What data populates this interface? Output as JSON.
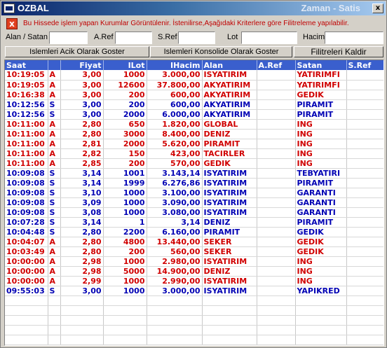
{
  "window": {
    "title": "OZBAL",
    "subtitle": "Zaman - Satis",
    "close_label": "x"
  },
  "info": {
    "icon_label": "x",
    "message": "Bu Hissede işlem yapan Kurumlar Görüntülenir. İstenilirse,Aşağıdaki Kriterlere göre Filitreleme yapılabilir."
  },
  "filters": {
    "alan_satan_label": "Alan / Satan",
    "aref_label": "A.Ref",
    "sref_label": "S.Ref",
    "lot_label": "Lot",
    "hacim_label": "Hacim",
    "alan_satan_value": "",
    "aref_value": "",
    "sref_value": "",
    "lot_value": "",
    "hacim_value": ""
  },
  "buttons": {
    "acik_label": "Islemleri Acik Olarak Goster",
    "konsolide_label": "Islemleri Konsolide Olarak Goster",
    "kaldir_label": "Filitreleri Kaldir"
  },
  "grid": {
    "columns": [
      "Saat",
      "",
      "Fiyat",
      "ILot",
      "IHacim",
      "Alan",
      "A.Ref",
      "Satan",
      "S.Ref"
    ],
    "colors": {
      "buy": "#d00000",
      "sell": "#0000b4",
      "header_bg": "#3a5fcd"
    },
    "rows": [
      {
        "saat": "10:19:05",
        "tip": "A",
        "fiyat": "3,00",
        "lot": "1000",
        "hacim": "3.000,00",
        "alan": "ISYATIRIM",
        "aref": "",
        "satan": "YATIRIMFI",
        "sref": ""
      },
      {
        "saat": "10:19:05",
        "tip": "A",
        "fiyat": "3,00",
        "lot": "12600",
        "hacim": "37.800,00",
        "alan": "AKYATIRIM",
        "aref": "",
        "satan": "YATIRIMFI",
        "sref": ""
      },
      {
        "saat": "10:16:38",
        "tip": "A",
        "fiyat": "3,00",
        "lot": "200",
        "hacim": "600,00",
        "alan": "AKYATIRIM",
        "aref": "",
        "satan": "GEDIK",
        "sref": ""
      },
      {
        "saat": "10:12:56",
        "tip": "S",
        "fiyat": "3,00",
        "lot": "200",
        "hacim": "600,00",
        "alan": "AKYATIRIM",
        "aref": "",
        "satan": "PIRAMIT",
        "sref": ""
      },
      {
        "saat": "10:12:56",
        "tip": "S",
        "fiyat": "3,00",
        "lot": "2000",
        "hacim": "6.000,00",
        "alan": "AKYATIRIM",
        "aref": "",
        "satan": "PIRAMIT",
        "sref": ""
      },
      {
        "saat": "10:11:00",
        "tip": "A",
        "fiyat": "2,80",
        "lot": "650",
        "hacim": "1.820,00",
        "alan": "GLOBAL",
        "aref": "",
        "satan": "ING",
        "sref": ""
      },
      {
        "saat": "10:11:00",
        "tip": "A",
        "fiyat": "2,80",
        "lot": "3000",
        "hacim": "8.400,00",
        "alan": "DENIZ",
        "aref": "",
        "satan": "ING",
        "sref": ""
      },
      {
        "saat": "10:11:00",
        "tip": "A",
        "fiyat": "2,81",
        "lot": "2000",
        "hacim": "5.620,00",
        "alan": "PIRAMIT",
        "aref": "",
        "satan": "ING",
        "sref": ""
      },
      {
        "saat": "10:11:00",
        "tip": "A",
        "fiyat": "2,82",
        "lot": "150",
        "hacim": "423,00",
        "alan": "TACIRLER",
        "aref": "",
        "satan": "ING",
        "sref": ""
      },
      {
        "saat": "10:11:00",
        "tip": "A",
        "fiyat": "2,85",
        "lot": "200",
        "hacim": "570,00",
        "alan": "GEDIK",
        "aref": "",
        "satan": "ING",
        "sref": ""
      },
      {
        "saat": "10:09:08",
        "tip": "S",
        "fiyat": "3,14",
        "lot": "1001",
        "hacim": "3.143,14",
        "alan": "ISYATIRIM",
        "aref": "",
        "satan": "TEBYATIRI",
        "sref": ""
      },
      {
        "saat": "10:09:08",
        "tip": "S",
        "fiyat": "3,14",
        "lot": "1999",
        "hacim": "6.276,86",
        "alan": "ISYATIRIM",
        "aref": "",
        "satan": "PIRAMIT",
        "sref": ""
      },
      {
        "saat": "10:09:08",
        "tip": "S",
        "fiyat": "3,10",
        "lot": "1000",
        "hacim": "3.100,00",
        "alan": "ISYATIRIM",
        "aref": "",
        "satan": "GARANTI",
        "sref": ""
      },
      {
        "saat": "10:09:08",
        "tip": "S",
        "fiyat": "3,09",
        "lot": "1000",
        "hacim": "3.090,00",
        "alan": "ISYATIRIM",
        "aref": "",
        "satan": "GARANTI",
        "sref": ""
      },
      {
        "saat": "10:09:08",
        "tip": "S",
        "fiyat": "3,08",
        "lot": "1000",
        "hacim": "3.080,00",
        "alan": "ISYATIRIM",
        "aref": "",
        "satan": "GARANTI",
        "sref": ""
      },
      {
        "saat": "10:07:28",
        "tip": "S",
        "fiyat": "3,14",
        "lot": "1",
        "hacim": "3,14",
        "alan": "DENIZ",
        "aref": "",
        "satan": "PIRAMIT",
        "sref": ""
      },
      {
        "saat": "10:04:48",
        "tip": "S",
        "fiyat": "2,80",
        "lot": "2200",
        "hacim": "6.160,00",
        "alan": "PIRAMIT",
        "aref": "",
        "satan": "GEDIK",
        "sref": ""
      },
      {
        "saat": "10:04:07",
        "tip": "A",
        "fiyat": "2,80",
        "lot": "4800",
        "hacim": "13.440,00",
        "alan": "SEKER",
        "aref": "",
        "satan": "GEDIK",
        "sref": ""
      },
      {
        "saat": "10:03:49",
        "tip": "A",
        "fiyat": "2,80",
        "lot": "200",
        "hacim": "560,00",
        "alan": "SEKER",
        "aref": "",
        "satan": "GEDIK",
        "sref": ""
      },
      {
        "saat": "10:00:00",
        "tip": "A",
        "fiyat": "2,98",
        "lot": "1000",
        "hacim": "2.980,00",
        "alan": "ISYATIRIM",
        "aref": "",
        "satan": "ING",
        "sref": ""
      },
      {
        "saat": "10:00:00",
        "tip": "A",
        "fiyat": "2,98",
        "lot": "5000",
        "hacim": "14.900,00",
        "alan": "DENIZ",
        "aref": "",
        "satan": "ING",
        "sref": ""
      },
      {
        "saat": "10:00:00",
        "tip": "A",
        "fiyat": "2,99",
        "lot": "1000",
        "hacim": "2.990,00",
        "alan": "ISYATIRIM",
        "aref": "",
        "satan": "ING",
        "sref": ""
      },
      {
        "saat": "09:55:03",
        "tip": "S",
        "fiyat": "3,00",
        "lot": "1000",
        "hacim": "3.000,00",
        "alan": "ISYATIRIM",
        "aref": "",
        "satan": "YAPIKRED",
        "sref": ""
      }
    ]
  }
}
